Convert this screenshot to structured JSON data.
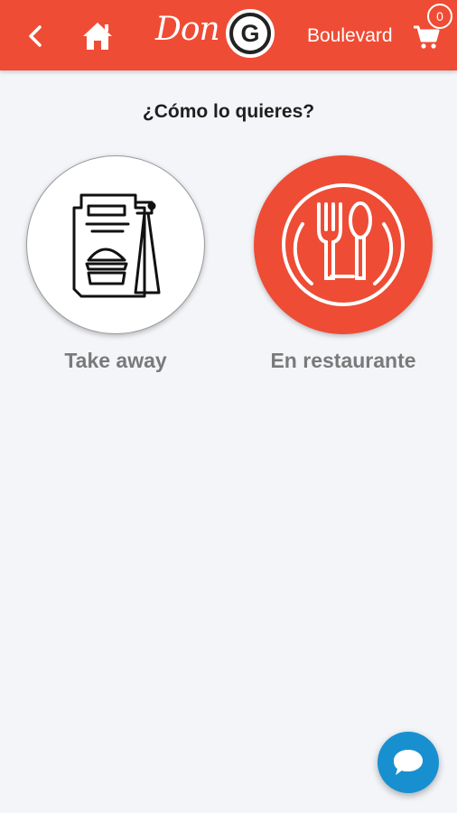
{
  "header": {
    "logo_text": "Don",
    "logo_badge": "G",
    "branch": "Boulevard",
    "cart_count": "0",
    "icons": [
      "back-arrow-icon",
      "home-icon",
      "cart-icon"
    ]
  },
  "question": "¿Cómo lo quieres?",
  "options": [
    {
      "label": "Take away",
      "icon": "takeaway-bag-icon",
      "color": "#ffffff"
    },
    {
      "label": "En restaurante",
      "icon": "fork-spoon-plate-icon",
      "color": "#ee4c35"
    }
  ],
  "chat": {
    "icon": "chat-bubble-icon",
    "color": "#1890d0"
  },
  "colors": {
    "brand": "#ef4c35",
    "background": "#f3f5f9",
    "label": "#7a7a7a"
  }
}
